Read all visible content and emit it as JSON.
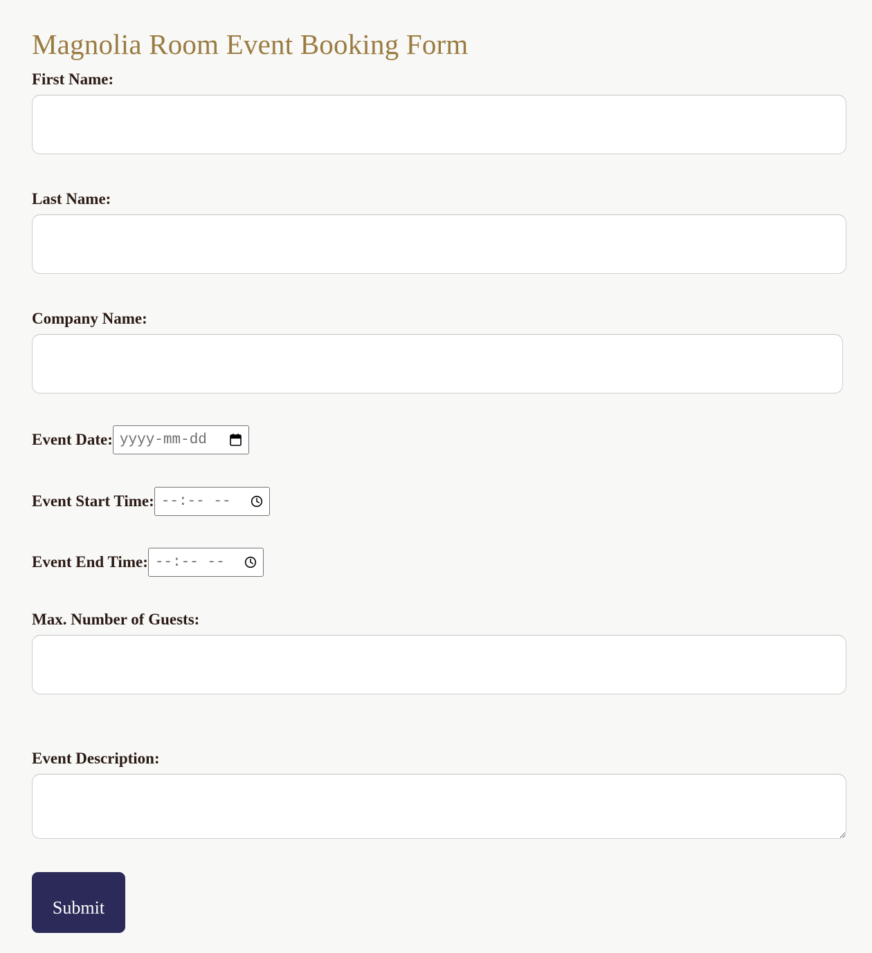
{
  "page": {
    "background_color": "#f8f8f7",
    "title": "Magnolia Room Event Booking Form",
    "title_color": "#9a7b40",
    "label_color": "#2b1a14"
  },
  "form": {
    "fields": {
      "first_name": {
        "label": "First Name:",
        "value": "",
        "placeholder": "",
        "type": "text"
      },
      "last_name": {
        "label": "Last Name:",
        "value": "",
        "placeholder": "",
        "type": "text"
      },
      "company_name": {
        "label": "Company Name:",
        "value": "",
        "placeholder": "",
        "type": "text"
      },
      "event_date": {
        "label": "Event Date:",
        "value": "",
        "placeholder": "yyyy-mm-dd",
        "type": "date",
        "icon": "calendar-icon"
      },
      "event_start_time": {
        "label": "Event Start Time:",
        "value": "",
        "placeholder": "--:-- --",
        "type": "time",
        "icon": "clock-icon"
      },
      "event_end_time": {
        "label": "Event End Time:",
        "value": "",
        "placeholder": "--:-- --",
        "type": "time",
        "icon": "clock-icon"
      },
      "max_guests": {
        "label": "Max. Number of Guests:",
        "value": "",
        "placeholder": "",
        "type": "number"
      },
      "event_description": {
        "label": "Event Description:",
        "value": "",
        "placeholder": "",
        "type": "textarea"
      }
    },
    "submit": {
      "label": "Submit",
      "background_color": "#2b2a58",
      "text_color": "#ffffff"
    }
  }
}
